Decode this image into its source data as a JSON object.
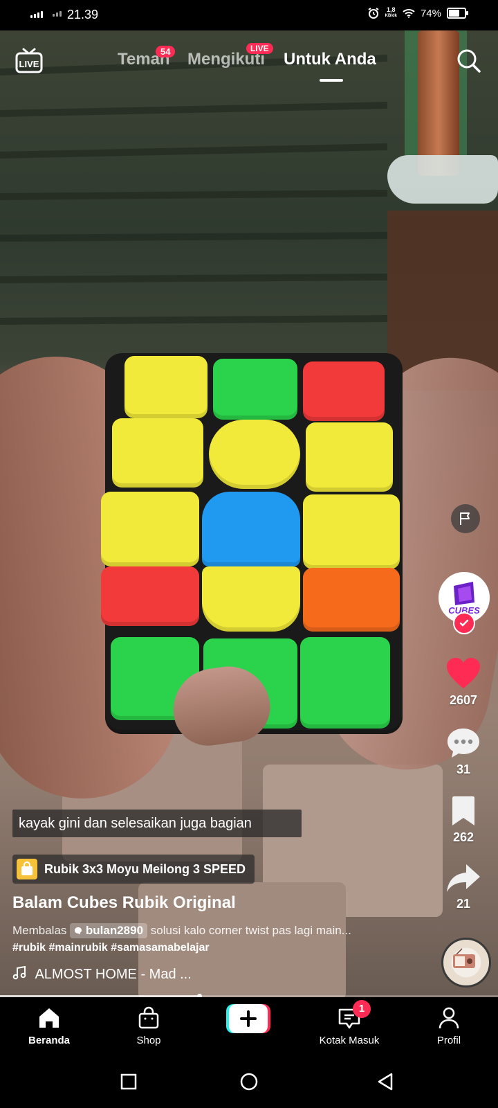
{
  "status_bar": {
    "time": "21.39",
    "net_speed_value": "1,8",
    "net_speed_unit": "KB/dk",
    "battery": "74%",
    "battery_level": 0.74
  },
  "top_nav": {
    "tabs": [
      {
        "label": "Teman",
        "badge": "54"
      },
      {
        "label": "Mengikuti",
        "badge": "LIVE"
      },
      {
        "label": "Untuk Anda",
        "active": true
      }
    ]
  },
  "side_actions": {
    "avatar_text": "CUBES",
    "likes": "2607",
    "comments": "31",
    "bookmarks": "262",
    "shares": "21"
  },
  "video_info": {
    "caption": "kayak gini dan selesaikan juga bagian",
    "product": "Rubik 3x3 Moyu Meilong 3 SPEED",
    "username": "Balam Cubes Rubik Original",
    "reply_prefix": "Membalas",
    "reply_mention": "bulan2890",
    "description": "solusi kalo corner twist pas lagi main...",
    "hashtags": "#rubik #mainrubik #samasamabelajar",
    "music": "ALMOST HOME - Mad ...",
    "progress": 0.4
  },
  "bottom_nav": {
    "items": [
      {
        "label": "Beranda",
        "active": true
      },
      {
        "label": "Shop"
      },
      {
        "label": "Kotak Masuk",
        "badge": "1"
      },
      {
        "label": "Profil"
      }
    ]
  },
  "colors": {
    "accent": "#fe2c55",
    "cube_yellow": "#f2ea3a",
    "cube_green": "#2bd24b",
    "cube_red": "#f23a3a",
    "cube_blue": "#1f9af0",
    "cube_orange": "#f66a1c"
  },
  "icons": [
    "live-icon",
    "search-icon",
    "flag-icon",
    "heart-icon",
    "comment-icon",
    "bookmark-icon",
    "share-icon",
    "music-note-icon",
    "shopping-bag-icon",
    "home-icon",
    "inbox-icon",
    "profile-icon",
    "plus-icon",
    "square-icon",
    "circle-icon",
    "back-triangle-icon"
  ]
}
